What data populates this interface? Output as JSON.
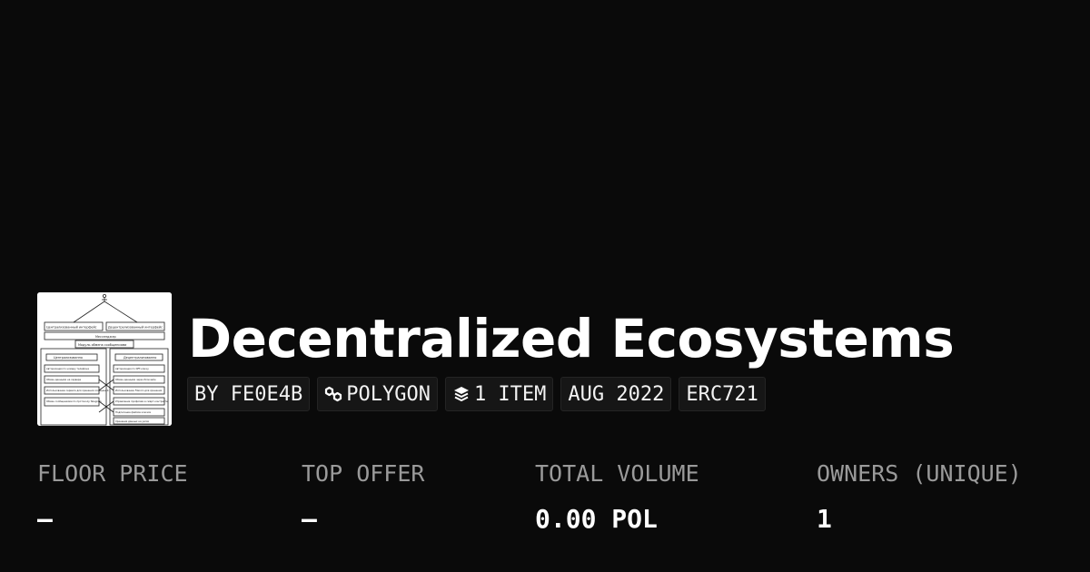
{
  "collection": {
    "title": "Decentralized Ecosystems",
    "thumbnail": {
      "top_left_label": "Централизованный интерфейс",
      "top_right_label": "Децентрализованный интерфейс",
      "middle_label": "Мессенджер",
      "module_label": "Модуль обмена сообщениями",
      "left_header": "Централизованно",
      "right_header": "Децентрализованно",
      "left_items": [
        "Авторизация по номеру телефона",
        "Обмен данными на сервере",
        "Использование сервиса для хранения сообщений",
        "Обмен сообщениями по протоколу Telegram"
      ],
      "right_items": [
        "Авторизация по NFT-ключу",
        "Обмен данными через блокчейн",
        "Использование Filecoin для хранения",
        "Управление профилем в смарт-контракте",
        "Подписание файлов ключом",
        "Хранение данных на узлах"
      ]
    }
  },
  "tags": [
    {
      "label": "BY FE0E4B",
      "icon": null
    },
    {
      "label": "POLYGON",
      "icon": "polygon-link-icon"
    },
    {
      "label": "1 ITEM",
      "icon": "layers-icon"
    },
    {
      "label": "AUG 2022",
      "icon": null
    },
    {
      "label": "ERC721",
      "icon": null
    }
  ],
  "stats": {
    "floor_price": {
      "label": "FLOOR PRICE",
      "value": "–"
    },
    "top_offer": {
      "label": "TOP OFFER",
      "value": "–"
    },
    "total_volume": {
      "label": "TOTAL VOLUME",
      "value": "0.00 POL"
    },
    "owners": {
      "label": "OWNERS (UNIQUE)",
      "value": "1"
    }
  }
}
